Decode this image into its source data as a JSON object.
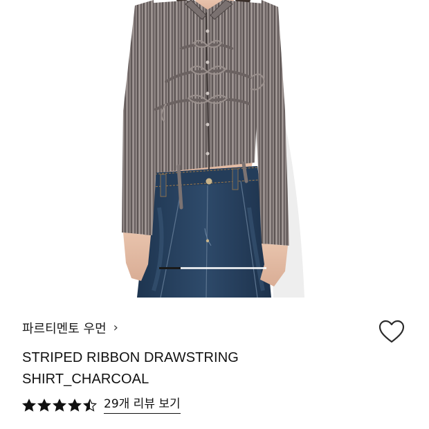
{
  "product": {
    "brand": "파르티멘토 우먼",
    "brand_chevron": "›",
    "title_line1": "STRIPED RIBBON DRAWSTRING",
    "title_line2": "SHIRT_CHARCOAL",
    "rating": 4.5,
    "review_link": "29개 리뷰 보기",
    "wishlist_icon": "heart-outline-icon",
    "image_carousel_progress": 0.2
  },
  "colors": {
    "shirt": "#8a8180",
    "denim": "#27405c",
    "text": "#111111"
  }
}
